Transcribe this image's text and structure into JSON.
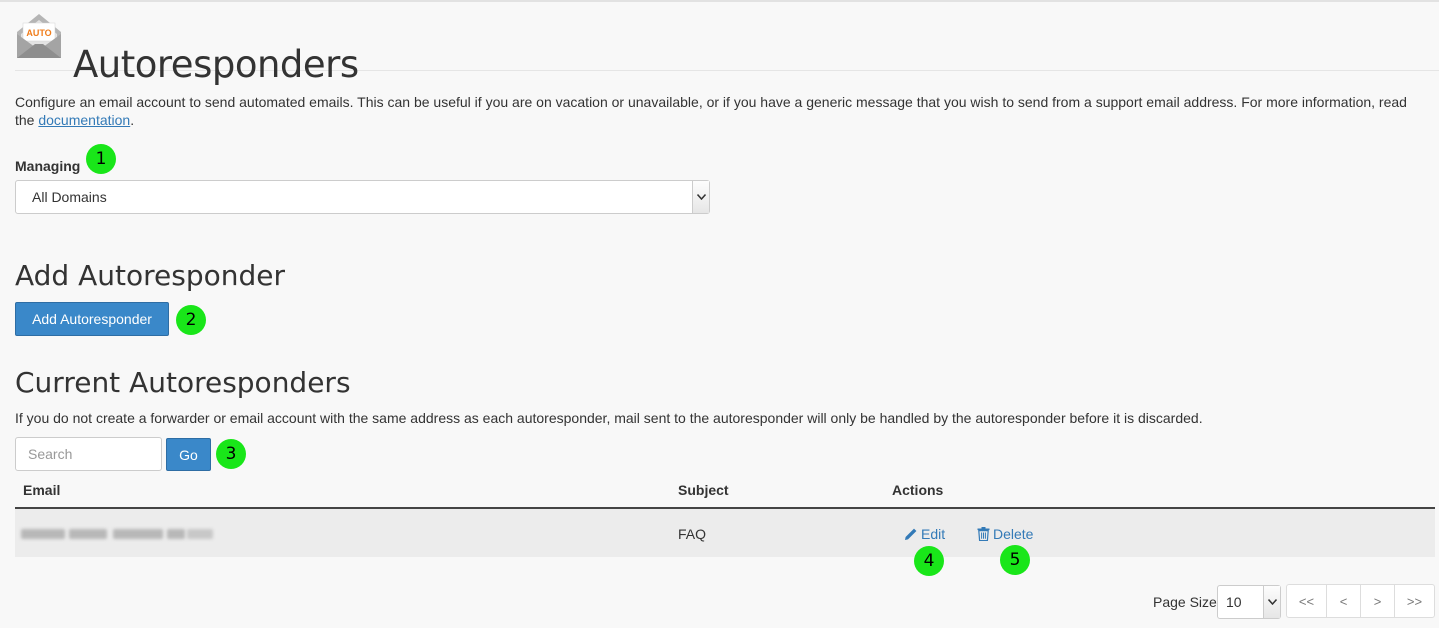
{
  "header": {
    "icon_text": "AUTO",
    "title": "Autoresponders"
  },
  "description": {
    "text": "Configure an email account to send automated emails. This can be useful if you are on vacation or unavailable, or if you have a generic message that you wish to send from a support email address. For more information, read the ",
    "link": "documentation",
    "end": "."
  },
  "managing": {
    "label": "Managing",
    "selected": "All Domains"
  },
  "add_section": {
    "title": "Add Autoresponder",
    "button": "Add Autoresponder"
  },
  "current_section": {
    "title": "Current Autoresponders",
    "description": "If you do not create a forwarder or email account with the same address as each autoresponder, mail sent to the autoresponder will only be handled by the autoresponder before it is discarded.",
    "search_placeholder": "Search",
    "go": "Go"
  },
  "table": {
    "headers": {
      "email": "Email",
      "subject": "Subject",
      "actions": "Actions"
    },
    "rows": [
      {
        "subject": "FAQ",
        "edit": "Edit",
        "delete": "Delete"
      }
    ]
  },
  "pagination": {
    "page_size_label": "Page Size",
    "page_size": "10",
    "first": "<<",
    "prev": "<",
    "next": ">",
    "last": ">>"
  },
  "callouts": [
    "1",
    "2",
    "3",
    "4",
    "5"
  ],
  "colors": {
    "primary_button": "#3a88c9",
    "link": "#337ab7",
    "callout": "#19e619",
    "icon_accent": "#f07c1a"
  }
}
